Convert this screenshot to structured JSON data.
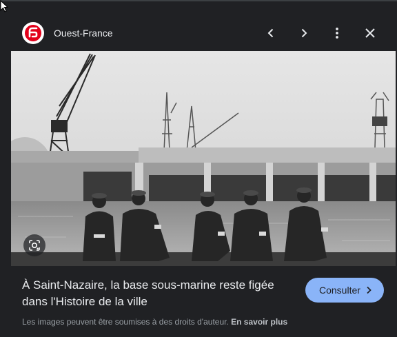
{
  "header": {
    "source_name": "Ouest-France",
    "logo_icon": "ouest-france-logo-icon",
    "logo_color": "#e2001a",
    "controls": [
      "chevron-left-icon",
      "chevron-right-icon",
      "more-vert-icon",
      "close-icon"
    ]
  },
  "image": {
    "content": "Archival black and white photo of submarine base with cranes and five men seated by the water",
    "lens_icon": "google-lens-icon"
  },
  "caption": {
    "text": "À Saint-Nazaire, la base sous-marine reste figée dans l'Histoire de la ville"
  },
  "visit_button": {
    "label": "Consulter",
    "color": "#8ab4f8"
  },
  "notice": {
    "text": "Les images peuvent être soumises à des droits d'auteur.",
    "link_label": "En savoir plus"
  },
  "colors": {
    "background": "#202124",
    "text": "#e8eaed",
    "muted_text": "#9aa0a6"
  }
}
